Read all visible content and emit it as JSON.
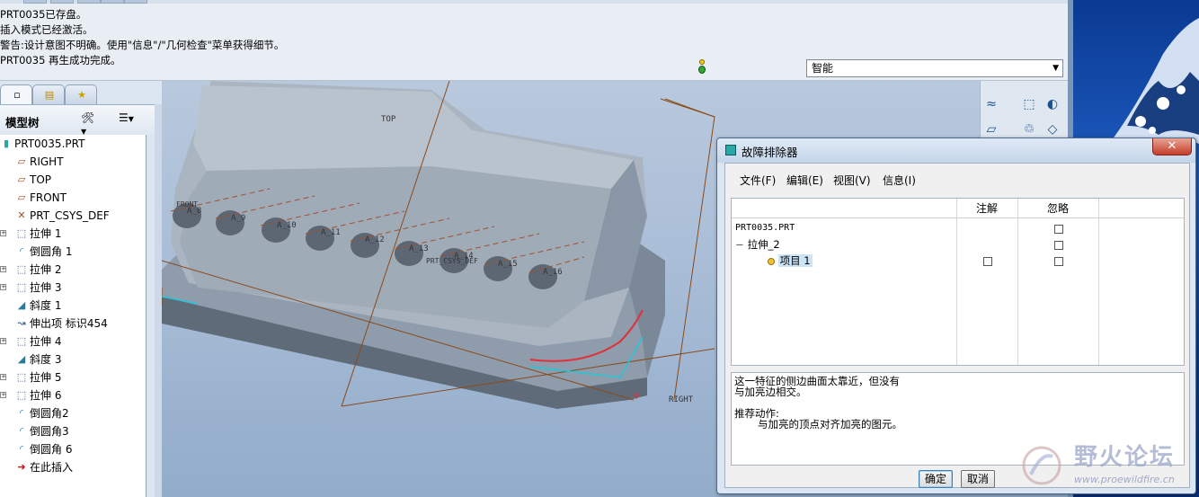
{
  "message_area": {
    "lines": [
      "PRT0035已存盘。",
      "插入模式已经激活。",
      "警告:设计意图不明确。使用\"信息\"/\"几何检查\"菜单获得细节。",
      "PRT0035 再生成功完成。"
    ],
    "filter_value": "智能",
    "filter_arrow": "▼"
  },
  "navigator": {
    "tab_icons": [
      "model-tree-icon",
      "folder-browser-icon",
      "favorites-icon"
    ],
    "title": "模型树",
    "settings_caret": "▼",
    "show_caret": "▼",
    "tree": [
      {
        "label": "PRT0035.PRT",
        "icon": "part-icon",
        "expand": "",
        "indent": 0
      },
      {
        "label": "RIGHT",
        "icon": "datum-plane-icon",
        "expand": "",
        "indent": 1
      },
      {
        "label": "TOP",
        "icon": "datum-plane-icon",
        "expand": "",
        "indent": 1
      },
      {
        "label": "FRONT",
        "icon": "datum-plane-icon",
        "expand": "",
        "indent": 1
      },
      {
        "label": "PRT_CSYS_DEF",
        "icon": "csys-icon",
        "expand": "",
        "indent": 1
      },
      {
        "label": "拉伸 1",
        "icon": "extrude-icon",
        "expand": "+",
        "indent": 1
      },
      {
        "label": "倒圆角 1",
        "icon": "round-icon",
        "expand": "",
        "indent": 1
      },
      {
        "label": "拉伸 2",
        "icon": "extrude-icon",
        "expand": "+",
        "indent": 1
      },
      {
        "label": "拉伸 3",
        "icon": "extrude-icon",
        "expand": "+",
        "indent": 1
      },
      {
        "label": "斜度 1",
        "icon": "draft-icon",
        "expand": "",
        "indent": 1
      },
      {
        "label": "伸出项 标识454",
        "icon": "protrusion-icon",
        "expand": "",
        "indent": 1
      },
      {
        "label": "拉伸 4",
        "icon": "extrude-icon",
        "expand": "+",
        "indent": 1
      },
      {
        "label": "斜度 3",
        "icon": "draft-icon",
        "expand": "",
        "indent": 1
      },
      {
        "label": "拉伸 5",
        "icon": "extrude-icon",
        "expand": "+",
        "indent": 1
      },
      {
        "label": "拉伸 6",
        "icon": "extrude-icon",
        "expand": "+",
        "indent": 1
      },
      {
        "label": "倒圆角2",
        "icon": "round-icon",
        "expand": "",
        "indent": 1
      },
      {
        "label": "倒圆角3",
        "icon": "round-icon",
        "expand": "",
        "indent": 1
      },
      {
        "label": "倒圆角 6",
        "icon": "round-icon",
        "expand": "",
        "indent": 1
      },
      {
        "label": "在此插入",
        "icon": "insert-here-icon",
        "expand": "",
        "indent": 1
      }
    ]
  },
  "viewport": {
    "datum_labels": {
      "top": "TOP",
      "right": "RIGHT",
      "front": "FRONT",
      "csys": "PRT_CSYS_DEF"
    },
    "axis_labels": [
      "A_8",
      "A_9",
      "A_10",
      "A_11",
      "A_12",
      "A_13",
      "A_14",
      "A_15",
      "A_16"
    ],
    "colors": {
      "model": "#9aa8b6",
      "datum_line": "#8a4a1a",
      "highlight_red": "#e0303a",
      "highlight_cyan": "#20c8d8"
    }
  },
  "dialog": {
    "title": "故障排除器",
    "close": "✕",
    "menu": [
      "文件(F)",
      "编辑(E)",
      "视图(V)",
      "信息(I)"
    ],
    "columns": {
      "note": "注解",
      "ignore": "忽略"
    },
    "rows": [
      {
        "label": "PRT0035.PRT",
        "level": 0
      },
      {
        "label": "拉伸_2",
        "level": 1,
        "expand": "−"
      },
      {
        "label": "项目 1",
        "level": 2
      }
    ],
    "message": "这一特征的侧边曲面太靠近，但没有\n与加亮边相交。",
    "action_title": "推荐动作:",
    "action_text": "与加亮的顶点对齐加亮的图元。",
    "ok_label": "确定",
    "cancel_label": "取消"
  },
  "watermark": {
    "text": "野火论坛",
    "url": "www.proewildfire.cn"
  }
}
